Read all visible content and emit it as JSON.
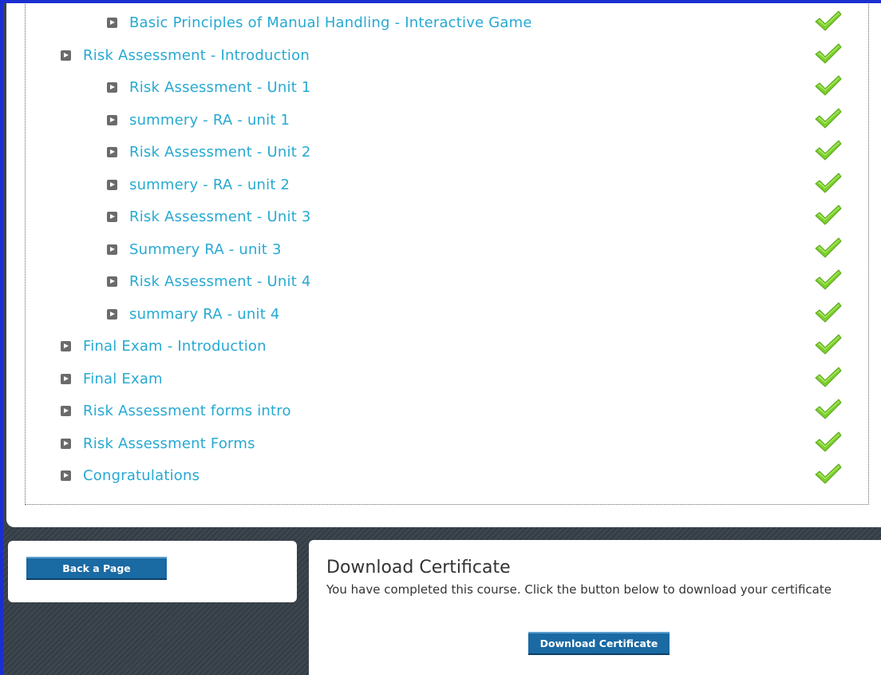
{
  "course_items": [
    {
      "label": "Basic Principles of Manual Handling - Interactive Game",
      "level": 2,
      "completed": true
    },
    {
      "label": "Risk Assessment - Introduction",
      "level": 1,
      "completed": true
    },
    {
      "label": "Risk Assessment - Unit 1",
      "level": 2,
      "completed": true
    },
    {
      "label": "summery - RA - unit 1",
      "level": 2,
      "completed": true
    },
    {
      "label": "Risk Assessment - Unit 2",
      "level": 2,
      "completed": true
    },
    {
      "label": "summery - RA - unit 2",
      "level": 2,
      "completed": true
    },
    {
      "label": "Risk Assessment - Unit 3",
      "level": 2,
      "completed": true
    },
    {
      "label": "Summery RA - unit 3",
      "level": 2,
      "completed": true
    },
    {
      "label": "Risk Assessment - Unit 4",
      "level": 2,
      "completed": true
    },
    {
      "label": "summary RA - unit 4",
      "level": 2,
      "completed": true
    },
    {
      "label": "Final Exam - Introduction",
      "level": 1,
      "completed": true
    },
    {
      "label": "Final Exam",
      "level": 1,
      "completed": true
    },
    {
      "label": "Risk Assessment forms intro",
      "level": 1,
      "completed": true
    },
    {
      "label": "Risk Assessment Forms",
      "level": 1,
      "completed": true
    },
    {
      "label": "Congratulations",
      "level": 1,
      "completed": true
    }
  ],
  "icons": {
    "bullet": "play-bullet-icon",
    "completed": "checkmark-icon"
  },
  "colors": {
    "link": "#27a9d2",
    "check": "#7ccf2a",
    "button": "#1a6aa3",
    "frame": "#1a2fd0"
  },
  "navigation": {
    "back_label": "Back a Page"
  },
  "certificate": {
    "title": "Download Certificate",
    "message": "You have completed this course. Click the button below to download your certificate",
    "button_label": "Download Certificate"
  }
}
